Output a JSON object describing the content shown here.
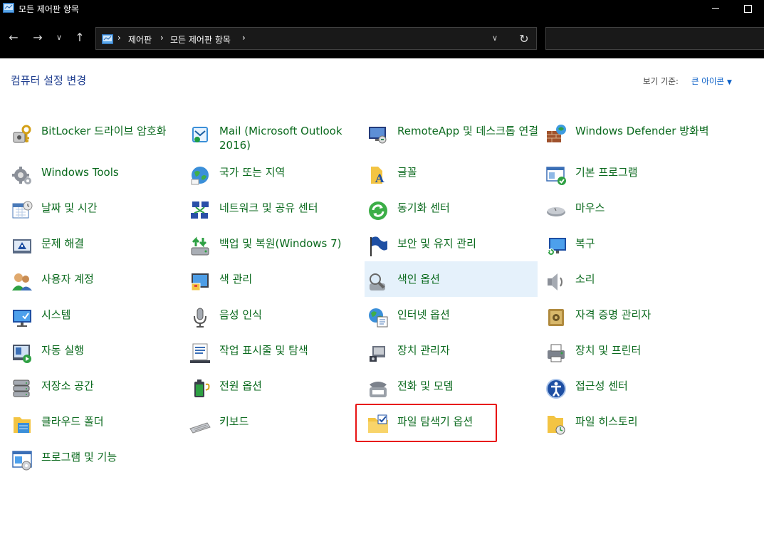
{
  "window": {
    "title": "모든 제어판 항목"
  },
  "address": {
    "crumbs": [
      "제어판",
      "모든 제어판 항목"
    ],
    "search_placeholder": ""
  },
  "header": {
    "title": "컴퓨터 설정 변경",
    "view_by_label": "보기 기준:",
    "view_by_value": "큰 아이콘"
  },
  "items": [
    {
      "label": "BitLocker 드라이브 암호화",
      "icon": "bitlocker-icon"
    },
    {
      "label": "Mail (Microsoft Outlook 2016)",
      "icon": "mail-icon"
    },
    {
      "label": "RemoteApp 및 데스크톱 연결",
      "icon": "remoteapp-icon"
    },
    {
      "label": "Windows Defender 방화벽",
      "icon": "firewall-icon"
    },
    {
      "label": "Windows Tools",
      "icon": "windows-tools-icon"
    },
    {
      "label": "국가 또는 지역",
      "icon": "region-icon"
    },
    {
      "label": "글꼴",
      "icon": "fonts-icon"
    },
    {
      "label": "기본 프로그램",
      "icon": "default-programs-icon"
    },
    {
      "label": "날짜 및 시간",
      "icon": "date-time-icon"
    },
    {
      "label": "네트워크 및 공유 센터",
      "icon": "network-icon"
    },
    {
      "label": "동기화 센터",
      "icon": "sync-center-icon"
    },
    {
      "label": "마우스",
      "icon": "mouse-icon"
    },
    {
      "label": "문제 해결",
      "icon": "troubleshooting-icon"
    },
    {
      "label": "백업 및 복원(Windows 7)",
      "icon": "backup-icon"
    },
    {
      "label": "보안 및 유지 관리",
      "icon": "security-flag-icon"
    },
    {
      "label": "복구",
      "icon": "recovery-icon"
    },
    {
      "label": "사용자 계정",
      "icon": "user-accounts-icon"
    },
    {
      "label": "색 관리",
      "icon": "color-management-icon"
    },
    {
      "label": "색인 옵션",
      "icon": "indexing-icon"
    },
    {
      "label": "소리",
      "icon": "sound-icon"
    },
    {
      "label": "시스템",
      "icon": "system-icon"
    },
    {
      "label": "음성 인식",
      "icon": "speech-icon"
    },
    {
      "label": "인터넷 옵션",
      "icon": "internet-options-icon"
    },
    {
      "label": "자격 증명 관리자",
      "icon": "credential-icon"
    },
    {
      "label": "자동 실행",
      "icon": "autoplay-icon"
    },
    {
      "label": "작업 표시줄 및 탐색",
      "icon": "taskbar-icon"
    },
    {
      "label": "장치 관리자",
      "icon": "device-manager-icon"
    },
    {
      "label": "장치 및 프린터",
      "icon": "printer-icon"
    },
    {
      "label": "저장소 공간",
      "icon": "storage-icon"
    },
    {
      "label": "전원 옵션",
      "icon": "power-icon"
    },
    {
      "label": "전화 및 모뎀",
      "icon": "phone-icon"
    },
    {
      "label": "접근성 센터",
      "icon": "accessibility-icon"
    },
    {
      "label": "클라우드 폴더",
      "icon": "cloud-folder-icon"
    },
    {
      "label": "키보드",
      "icon": "keyboard-icon"
    },
    {
      "label": "파일 탐색기 옵션",
      "icon": "folder-options-icon"
    },
    {
      "label": "파일 히스토리",
      "icon": "file-history-icon"
    },
    {
      "label": "프로그램 및 기능",
      "icon": "programs-icon"
    }
  ],
  "colors": {
    "link_green": "#0b6a1e",
    "heading_blue": "#1e3d8f",
    "hover_bg": "#e5f1fb",
    "highlight_red": "#e81313"
  }
}
